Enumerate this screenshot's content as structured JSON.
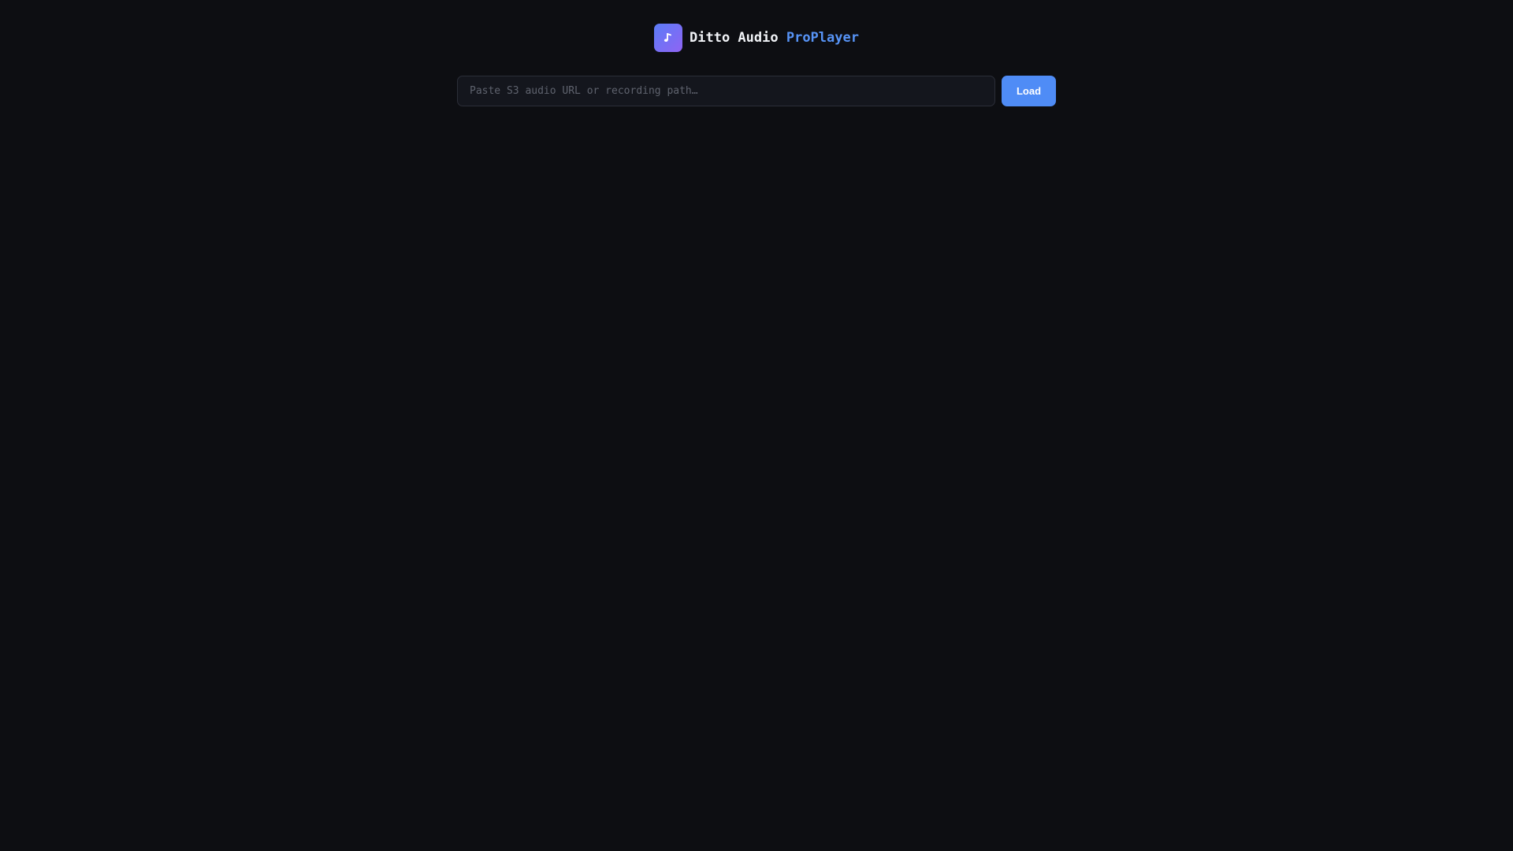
{
  "app": {
    "title_main": "Ditto Audio ",
    "title_accent": "ProPlayer",
    "logo_icon": "music-note-icon"
  },
  "loader": {
    "placeholder": "Paste S3 audio URL or recording path…",
    "value": "",
    "load_label": "Load"
  },
  "colors": {
    "background": "#0d0e12",
    "accent": "#5794f7",
    "button": "#4f8cf6",
    "logo_gradient_start": "#5b7cf7",
    "logo_gradient_end": "#8f64f3"
  }
}
